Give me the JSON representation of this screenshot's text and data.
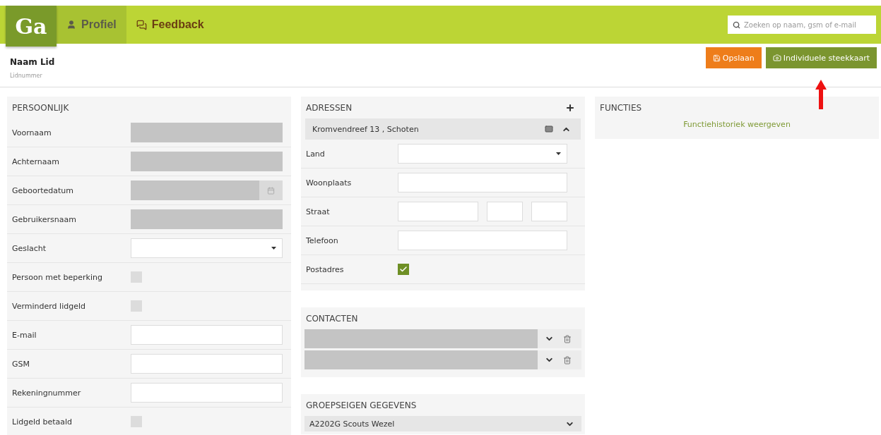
{
  "logo": {
    "text": "Ga"
  },
  "nav": [
    {
      "label": "Profiel",
      "selected": true
    },
    {
      "label": "Feedback",
      "selected": false
    }
  ],
  "search": {
    "placeholder": "Zoeken op naam, gsm of e-mail"
  },
  "member": {
    "name": "Naam Lid",
    "number_label": "Lidnummer"
  },
  "actions": [
    {
      "label": "Opslaan",
      "kind": "save",
      "pointed": false
    },
    {
      "label": "Individuele steekkaart",
      "kind": "card",
      "pointed": true
    }
  ],
  "persoonlijk": {
    "title": "PERSOONLIJK",
    "fields": [
      {
        "label": "Voornaam",
        "kind": "locked"
      },
      {
        "label": "Achternaam",
        "kind": "locked"
      },
      {
        "label": "Geboortedatum",
        "kind": "date"
      },
      {
        "label": "Gebruikersnaam",
        "kind": "locked"
      },
      {
        "label": "Geslacht",
        "kind": "select"
      },
      {
        "label": "Persoon met beperking",
        "kind": "checkbox",
        "checked": false
      },
      {
        "label": "Verminderd lidgeld",
        "kind": "checkbox",
        "checked": false
      },
      {
        "label": "E-mail",
        "kind": "input"
      },
      {
        "label": "GSM",
        "kind": "input"
      },
      {
        "label": "Rekeningnummer",
        "kind": "input"
      },
      {
        "label": "Lidgeld betaald",
        "kind": "checkbox",
        "checked": false
      }
    ]
  },
  "adressen": {
    "title": "ADRESSEN",
    "address": {
      "text": "Kromvendreef 13 , Schoten",
      "expanded": true
    },
    "fields": [
      {
        "label": "Land",
        "kind": "select"
      },
      {
        "label": "Woonplaats",
        "kind": "input"
      },
      {
        "label": "Straat",
        "kind": "street"
      },
      {
        "label": "Telefoon",
        "kind": "input"
      },
      {
        "label": "Postadres",
        "kind": "checkbox",
        "checked": true
      }
    ]
  },
  "contacten": {
    "title": "CONTACTEN",
    "rows": [
      {
        "kind": "locked"
      },
      {
        "kind": "locked"
      }
    ]
  },
  "groepseigen": {
    "title": "GROEPSEIGEN GEGEVENS",
    "groups": [
      {
        "name": "A2202G Scouts Wezel",
        "expanded": false
      }
    ]
  },
  "functies": {
    "title": "FUNCTIES",
    "link": "Functiehistoriek weergeven"
  }
}
